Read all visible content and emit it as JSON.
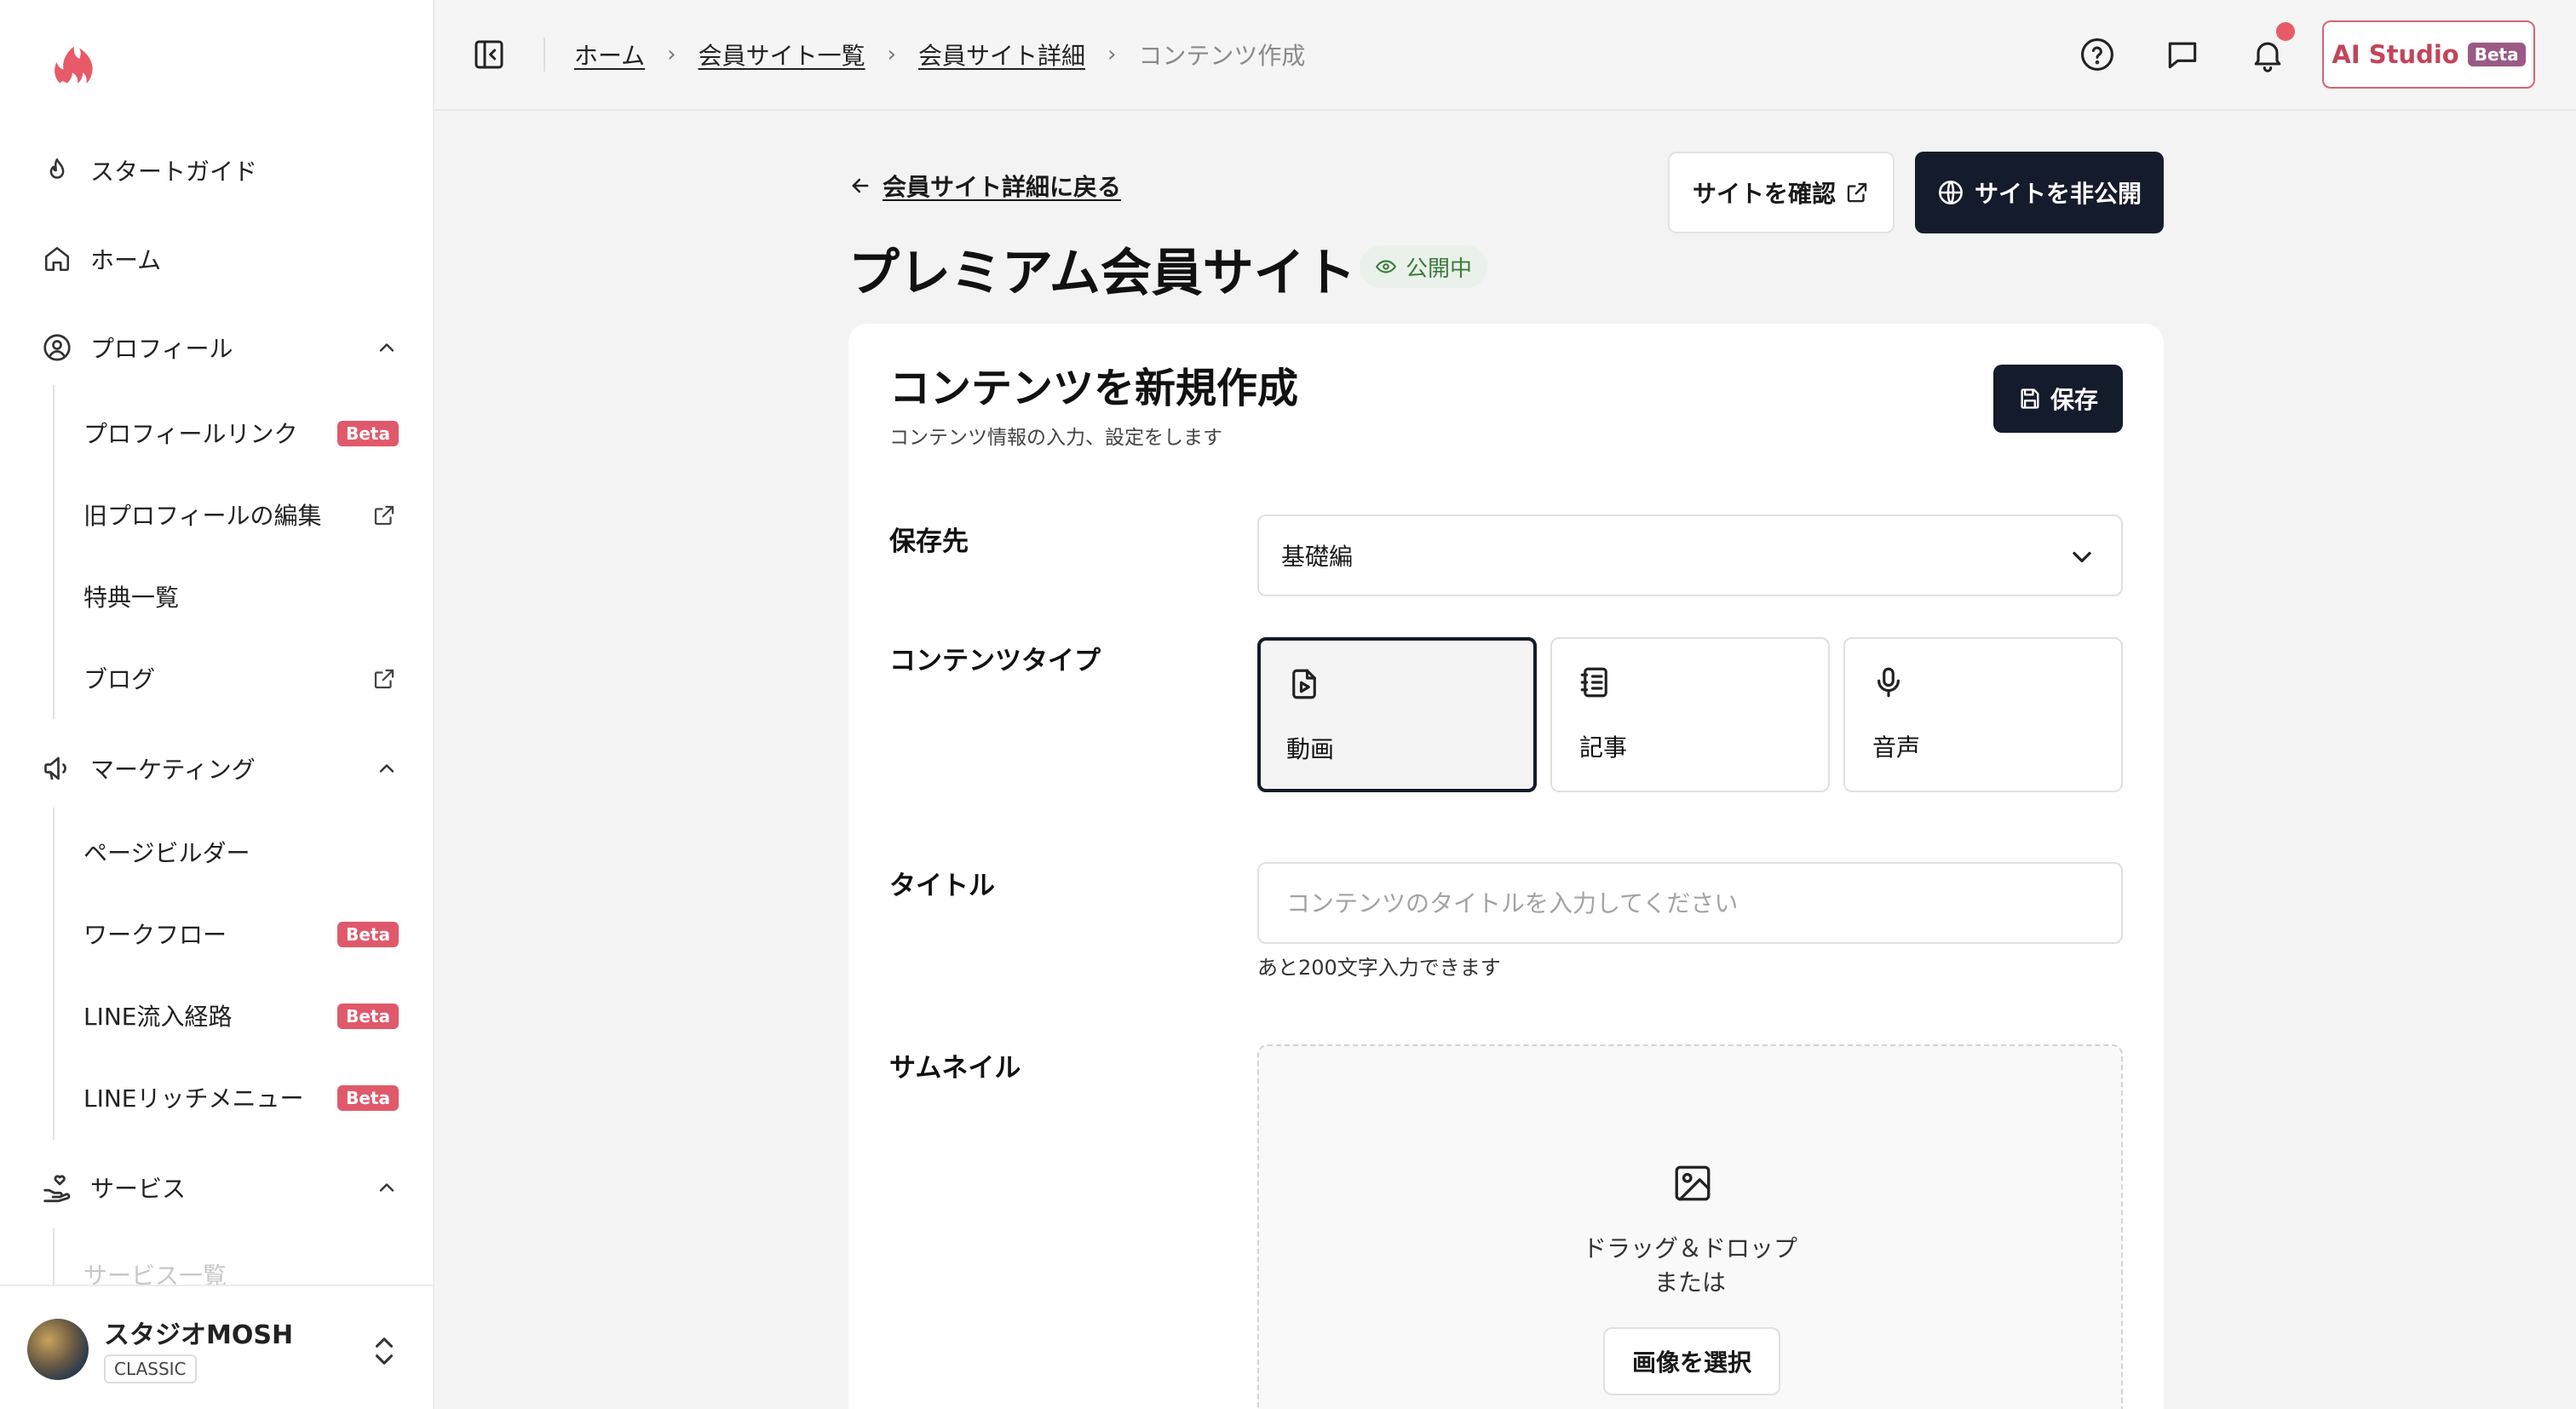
{
  "sidebar": {
    "nav": [
      {
        "label": "スタートガイド",
        "icon": "flame-icon"
      },
      {
        "label": "ホーム",
        "icon": "home-icon"
      },
      {
        "label": "プロフィール",
        "icon": "user-circle-icon"
      },
      {
        "label": "マーケティング",
        "icon": "megaphone-icon"
      },
      {
        "label": "サービス",
        "icon": "hand-heart-icon"
      }
    ],
    "profile_sub": [
      {
        "label": "プロフィールリンク",
        "badge": "Beta"
      },
      {
        "label": "旧プロフィールの編集"
      },
      {
        "label": "特典一覧"
      },
      {
        "label": "ブログ"
      }
    ],
    "marketing_sub": [
      {
        "label": "ページビルダー"
      },
      {
        "label": "ワークフロー",
        "badge": "Beta"
      },
      {
        "label": "LINE流入経路",
        "badge": "Beta"
      },
      {
        "label": "LINEリッチメニュー",
        "badge": "Beta"
      }
    ],
    "service_sub": [
      {
        "label": "サービス一覧"
      }
    ],
    "account": {
      "name": "スタジオMOSH",
      "plan": "CLASSIC"
    }
  },
  "header": {
    "breadcrumbs": [
      "ホーム",
      "会員サイト一覧",
      "会員サイト詳細",
      "コンテンツ作成"
    ],
    "ai_studio": {
      "label": "AI Studio",
      "badge": "Beta"
    }
  },
  "page": {
    "back_label": "会員サイト詳細に戻る",
    "title": "プレミアム会員サイト",
    "status": "公開中",
    "view_site_label": "サイトを確認",
    "unpublish_label": "サイトを非公開"
  },
  "form": {
    "title": "コンテンツを新規作成",
    "subtitle": "コンテンツ情報の入力、設定をします",
    "save_label": "保存",
    "destination": {
      "label": "保存先",
      "value": "基礎編"
    },
    "content_type": {
      "label": "コンテンツタイプ",
      "options": [
        {
          "label": "動画",
          "icon": "video-file-icon",
          "selected": true
        },
        {
          "label": "記事",
          "icon": "notebook-icon",
          "selected": false
        },
        {
          "label": "音声",
          "icon": "microphone-icon",
          "selected": false
        }
      ]
    },
    "content_title": {
      "label": "タイトル",
      "value": "",
      "placeholder": "コンテンツのタイトルを入力してください",
      "hint": "あと200文字入力できます"
    },
    "thumbnail": {
      "label": "サムネイル",
      "drop_text": "ドラッグ＆ドロップ",
      "or_text": "または",
      "select_label": "画像を選択"
    }
  },
  "colors": {
    "brand": "#e85a68",
    "primary_dark": "#141b2a",
    "beta_badge": "#e0596b",
    "status_green": "#3c7a3c"
  }
}
